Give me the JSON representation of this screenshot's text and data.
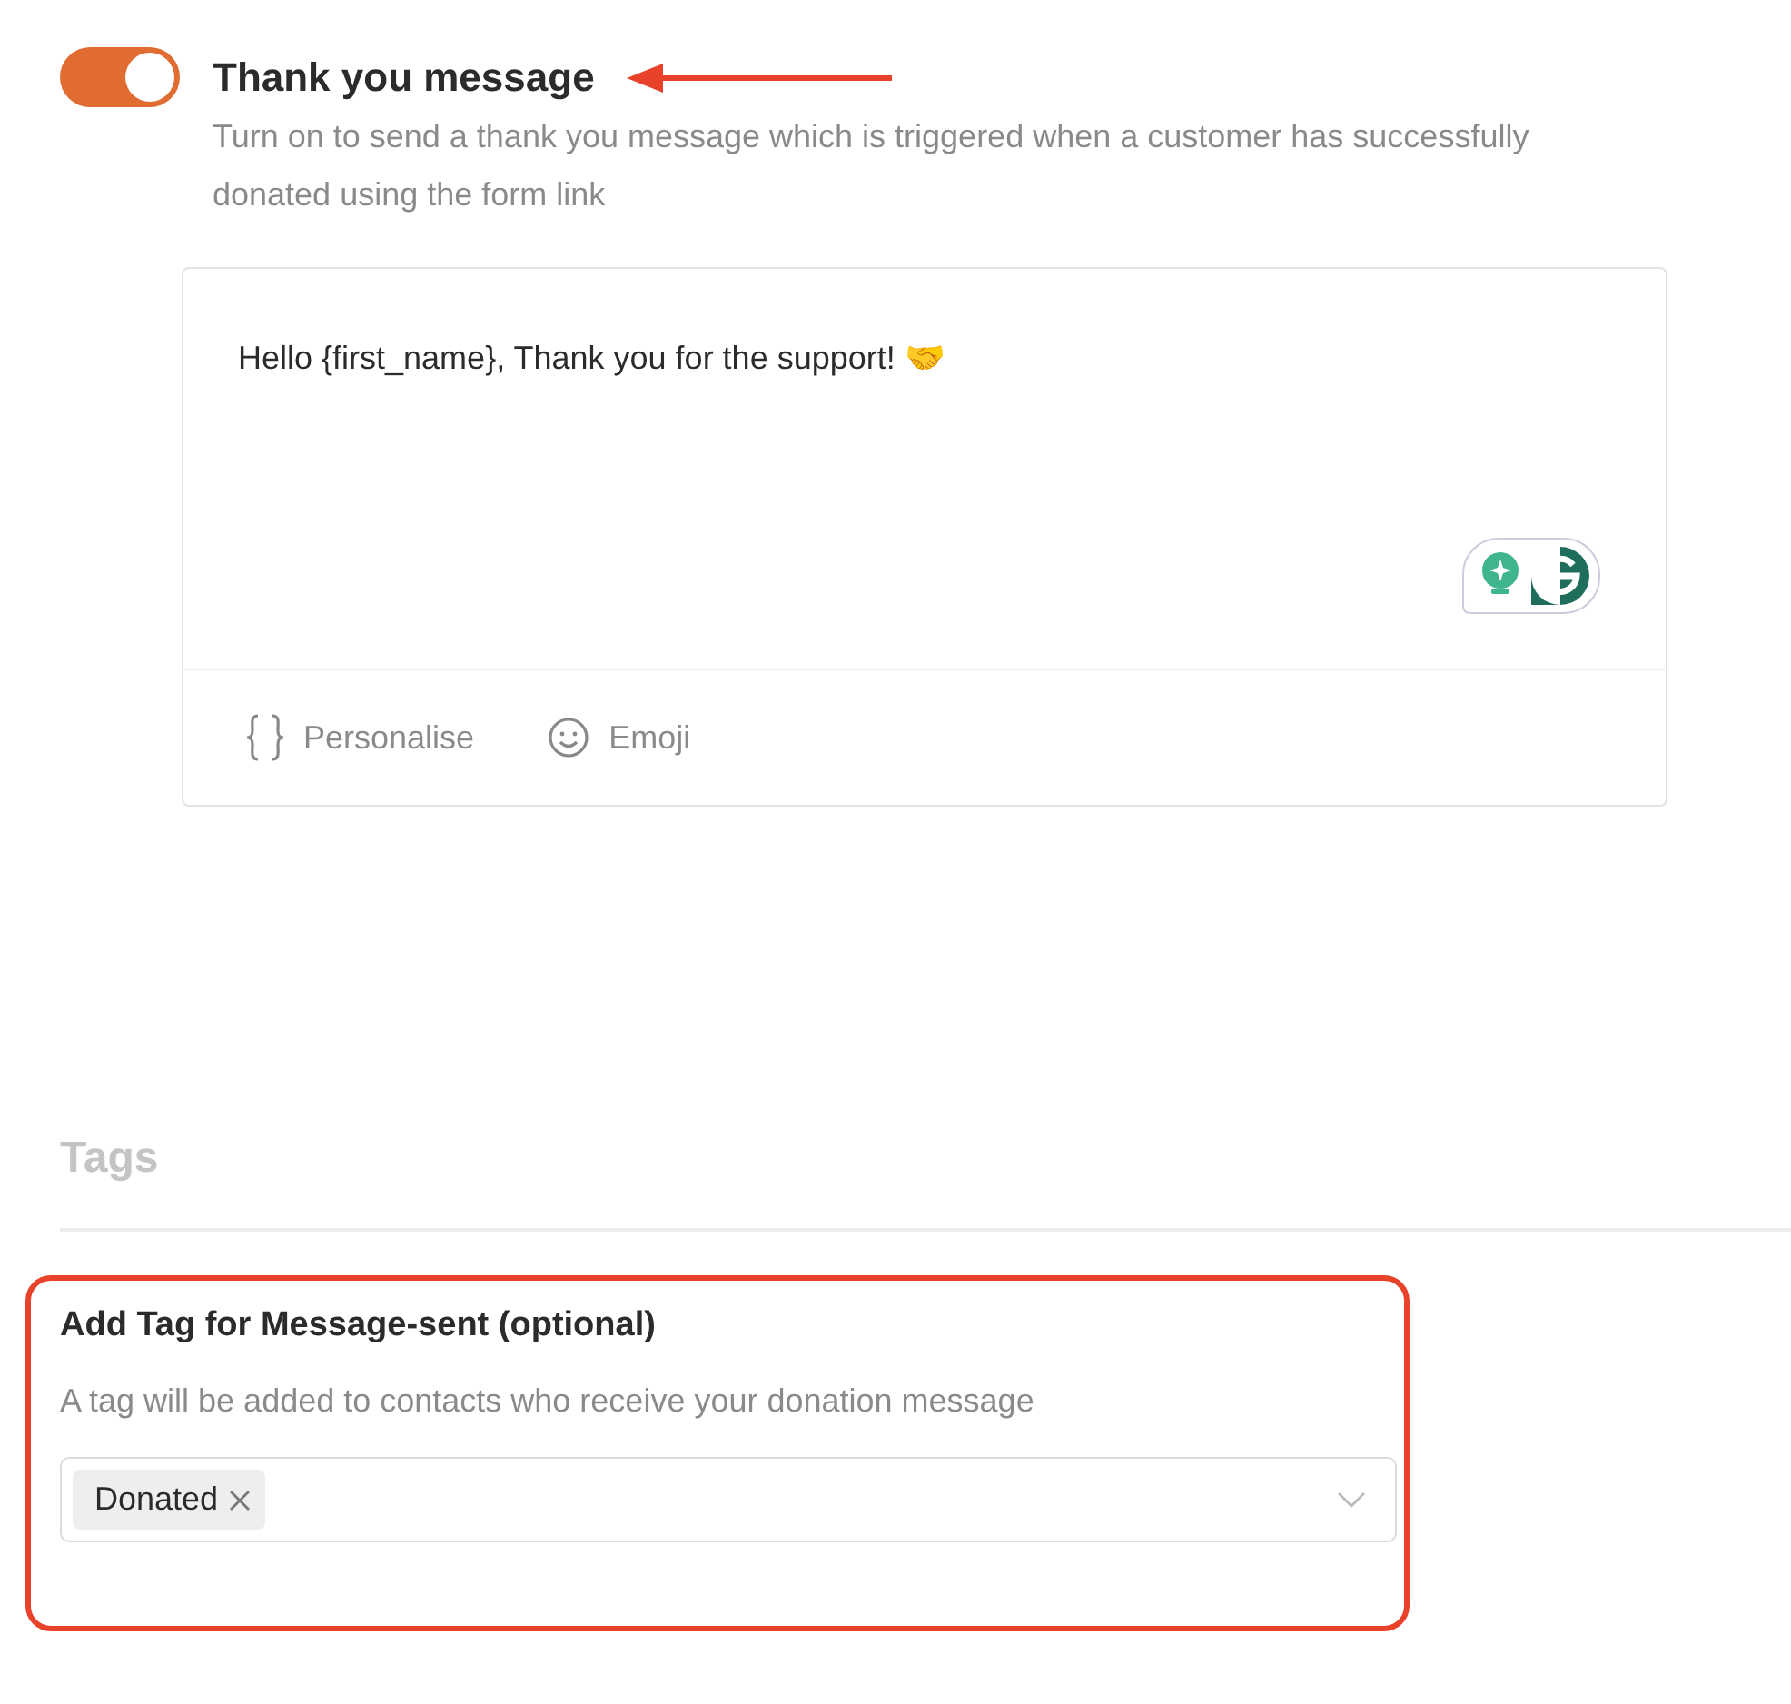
{
  "thank_you": {
    "toggle": {
      "on": true
    },
    "title": "Thank you message",
    "description": "Turn on to send a thank you message which is triggered when a customer has successfully donated using the form link",
    "editor": {
      "message": "Hello {first_name}, Thank you for the support! 🤝",
      "tools": [
        {
          "kind": "braces",
          "label": "Personalise"
        },
        {
          "kind": "smiley",
          "label": "Emoji"
        }
      ]
    }
  },
  "tags": {
    "heading": "Tags",
    "field": {
      "label": "Add Tag for Message-sent (optional)",
      "help": "A tag will be added to contacts who receive your donation message",
      "chips": [
        "Donated"
      ]
    }
  }
}
